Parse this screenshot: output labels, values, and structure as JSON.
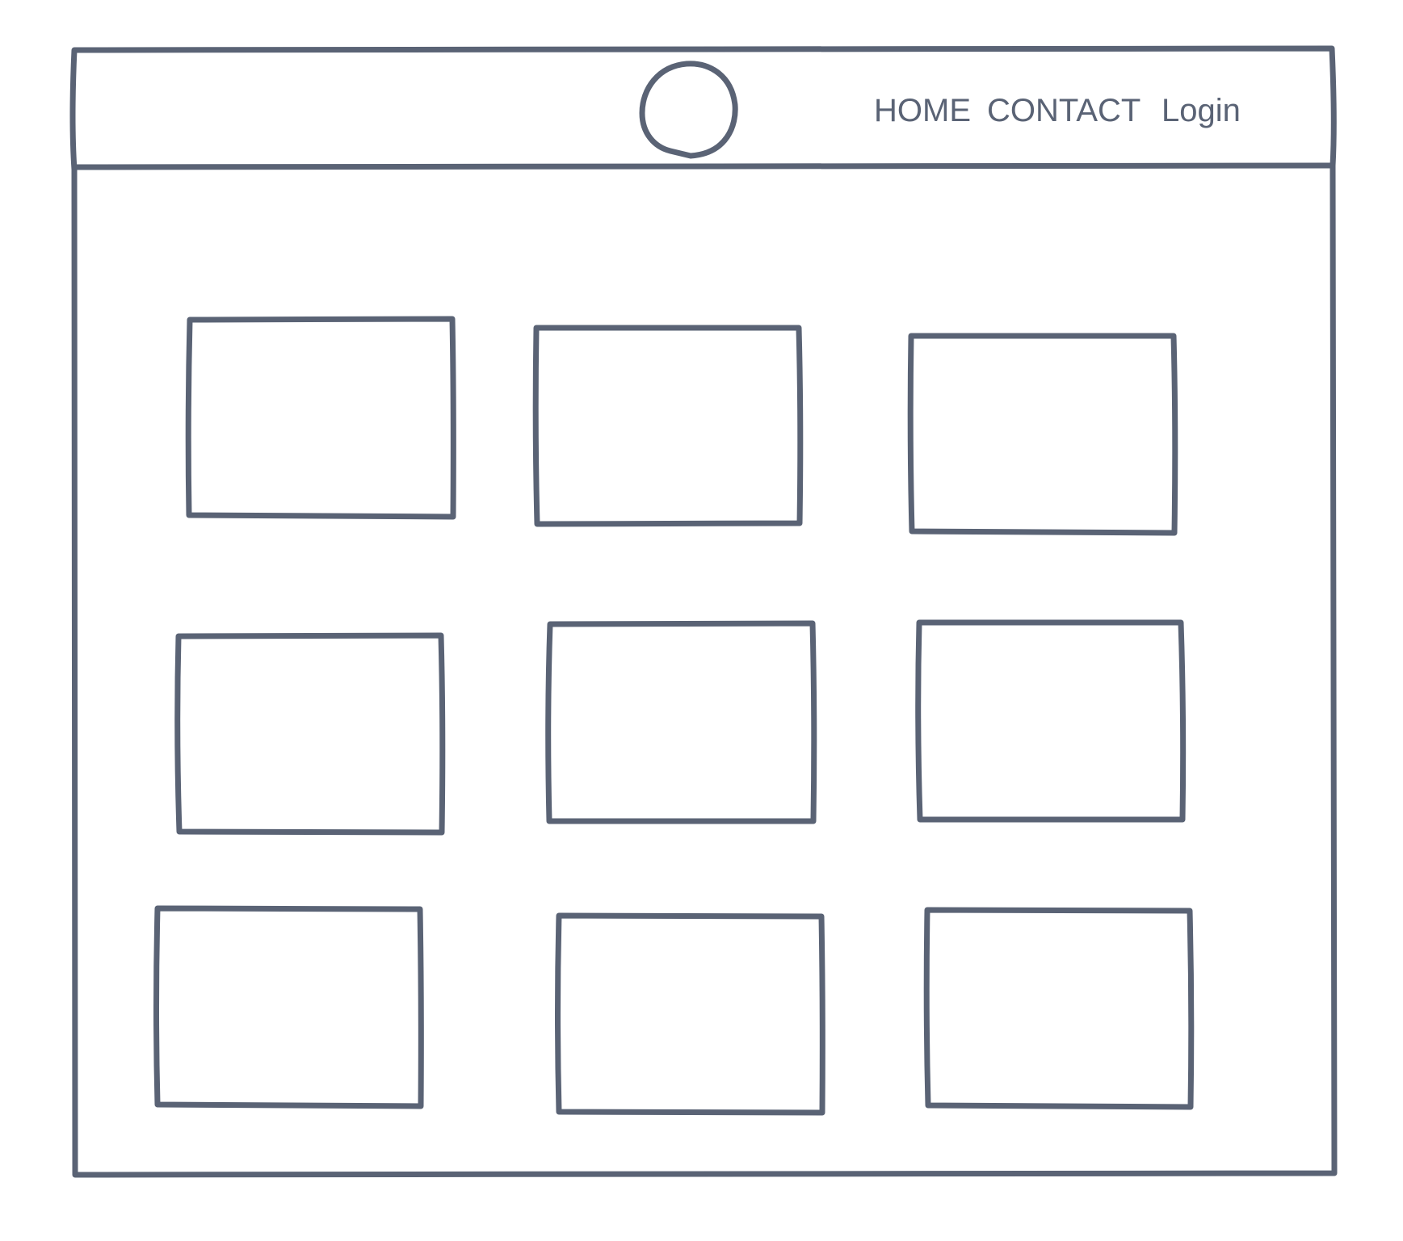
{
  "nav": {
    "items": [
      {
        "label": "HOME"
      },
      {
        "label": "CONTACT"
      },
      {
        "label": "Login"
      }
    ]
  },
  "logo": {
    "icon": "circle-logo-placeholder"
  },
  "grid": {
    "rows": 3,
    "columns": 3,
    "card_count": 9
  },
  "colors": {
    "stroke": "#5a6375",
    "background": "#ffffff"
  }
}
